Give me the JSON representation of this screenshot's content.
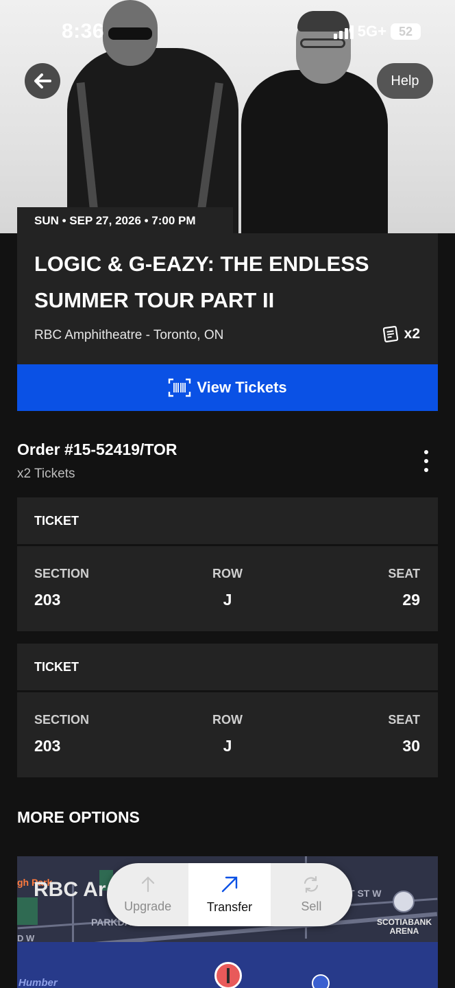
{
  "status_bar": {
    "time": "8:36",
    "network": "5G+",
    "battery": "52"
  },
  "hero": {
    "help_label": "Help"
  },
  "event": {
    "date_line": "SUN • SEP 27, 2026 • 7:00 PM",
    "title": "LOGIC & G-EAZY: THE ENDLESS SUMMER TOUR PART II",
    "venue": "RBC Amphitheatre - Toronto, ON",
    "ticket_count": "x2",
    "view_tickets_label": "View Tickets"
  },
  "order": {
    "number": "Order #15-52419/TOR",
    "subtitle": "x2 Tickets"
  },
  "tickets": [
    {
      "header": "TICKET",
      "section_label": "SECTION",
      "section": "203",
      "row_label": "ROW",
      "row": "J",
      "seat_label": "SEAT",
      "seat": "29"
    },
    {
      "header": "TICKET",
      "section_label": "SECTION",
      "section": "203",
      "row_label": "ROW",
      "row": "J",
      "seat_label": "SEAT",
      "seat": "30"
    }
  ],
  "more_options": {
    "title": "MORE OPTIONS"
  },
  "map": {
    "venue_label": "RBC Ar",
    "park_label": "gh Park",
    "parkdale_label": "PARKDALE",
    "street_label": "T ST W",
    "arena_label": "SCOTIABANK ARENA",
    "w_label": "D W",
    "humber_label": "Humber"
  },
  "actions": [
    {
      "label": "Upgrade",
      "icon": "arrow-up-icon",
      "state": "disabled"
    },
    {
      "label": "Transfer",
      "icon": "arrow-up-right-icon",
      "state": "active"
    },
    {
      "label": "Sell",
      "icon": "refresh-icon",
      "state": "disabled"
    }
  ],
  "colors": {
    "accent": "#0a51e5",
    "card": "#232323",
    "background": "#121212"
  }
}
